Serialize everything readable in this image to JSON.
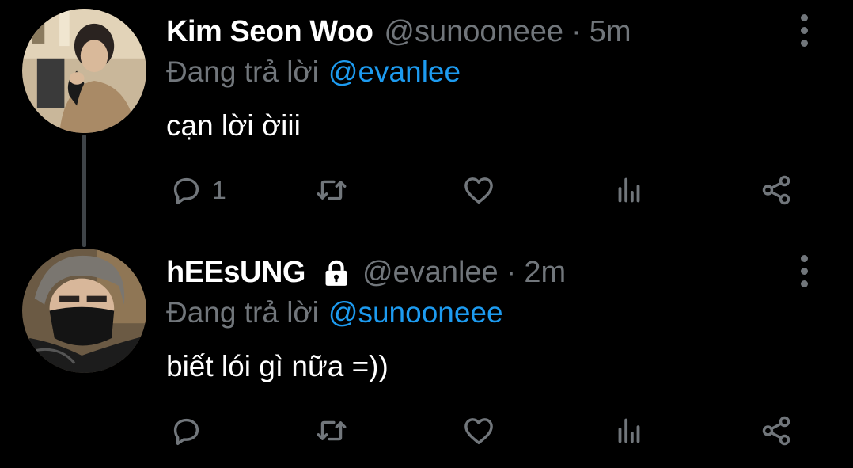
{
  "colors": {
    "background": "#000000",
    "name_text": "#ffffff",
    "muted_text": "#71767b",
    "link": "#1d9bf0",
    "thread_line": "#3f4448"
  },
  "tweets": [
    {
      "display_name": "Kim Seon Woo",
      "handle": "@sunooneee",
      "separator": "·",
      "time": "5m",
      "reply_prefix": "Đang trả lời",
      "reply_to": "@evanlee",
      "text": "cạn lời ờiii",
      "protected": false,
      "reply_count": "1",
      "icons": [
        "more-vertical-icon",
        "reply-icon",
        "retweet-icon",
        "like-icon",
        "views-icon",
        "share-icon"
      ]
    },
    {
      "display_name": "hEEsUNG",
      "handle": "@evanlee",
      "separator": "·",
      "time": "2m",
      "reply_prefix": "Đang trả lời",
      "reply_to": "@sunooneee",
      "text": "biết lói gì nữa =))",
      "protected": true,
      "reply_count": "",
      "icons": [
        "lock-icon",
        "more-vertical-icon",
        "reply-icon",
        "retweet-icon",
        "like-icon",
        "views-icon",
        "share-icon"
      ]
    }
  ]
}
